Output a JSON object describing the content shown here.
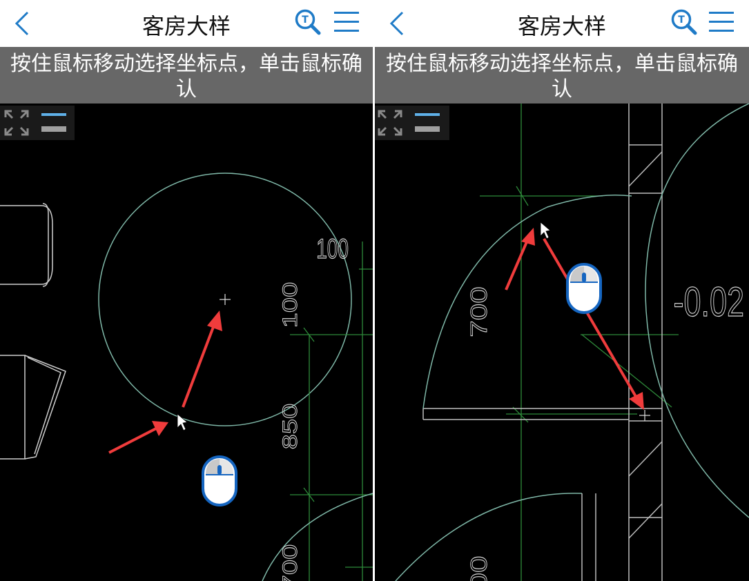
{
  "left": {
    "nav": {
      "title": "客房大样",
      "back_icon": "chevron-left-icon",
      "search_icon": "search-icon",
      "menu_icon": "menu-icon"
    },
    "hint": {
      "line1": "按住鼠标移动选择坐标点，单击鼠标确",
      "line2": "认"
    },
    "toolbox": {
      "fullscreen_icon": "fullscreen-icon",
      "layers_icon": "layers-icon"
    },
    "drawing": {
      "dims": [
        "100",
        "100",
        "850",
        "700"
      ]
    }
  },
  "right": {
    "nav": {
      "title": "客房大样",
      "back_icon": "chevron-left-icon",
      "search_icon": "search-icon",
      "menu_icon": "menu-icon"
    },
    "hint": {
      "line1": "按住鼠标移动选择坐标点，单击鼠标确",
      "line2": "认"
    },
    "toolbox": {
      "fullscreen_icon": "fullscreen-icon",
      "layers_icon": "layers-icon"
    },
    "drawing": {
      "dims": [
        "700",
        "-0.02",
        "00"
      ]
    }
  },
  "colors": {
    "accent": "#1F7BC7",
    "hint_bg": "#676767",
    "canvas_bg": "#000000",
    "cad_green": "#2E8B3A",
    "cad_teal": "#7FB8A8",
    "arrow_red": "#F03C3C",
    "mouse_blue": "#1565C0"
  }
}
